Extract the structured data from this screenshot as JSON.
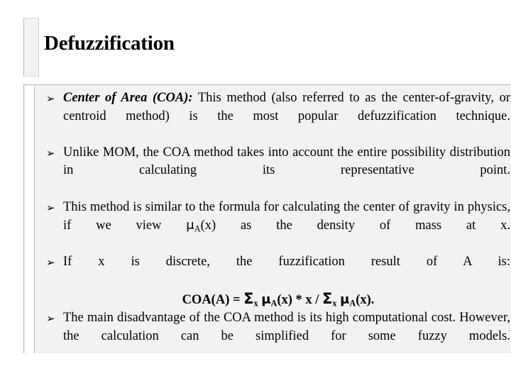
{
  "slide": {
    "title": "Defuzzification",
    "bullet_marker": "➢",
    "colors": {
      "page_background": "#ffffff",
      "content_background": "#f2f2f2",
      "text": "#000000",
      "border": "#b5b5b5",
      "deco_bar": "#f2f2f2"
    },
    "bullets": [
      {
        "id": "coa-definition",
        "lead_in": "Center of Area (COA):",
        "text": " This method (also referred to as the center-of-gravity, or centroid method) is the most popular defuzzification technique."
      },
      {
        "id": "unlike-mom",
        "lead_in": "",
        "text": "Unlike MOM, the COA method takes into account the entire possibility distribution in calculating its representative point."
      },
      {
        "id": "center-of-gravity-analogy",
        "lead_in": "",
        "text_part1": "This method is similar to the formula for calculating the center of gravity in physics, if we view ",
        "mu": "μ",
        "mu_subscript": "A",
        "text_part2": "(x) as the density of mass at x."
      },
      {
        "id": "discrete-case",
        "lead_in": "",
        "text": "If x is discrete, the fuzzification result of A is:",
        "formula": {
          "prefix": "COA(A) = ",
          "sigma1": "Σ",
          "sigma1_sub": "x",
          "mu1": "μ",
          "mu1_sub": "A",
          "mid": "(x) * x / ",
          "sigma2": "Σ",
          "sigma2_sub": "x",
          "mu2": "μ",
          "mu2_sub": "A",
          "suffix": "(x).",
          "plain": "COA(A) = Σx μA(x) * x / Σx μA(x)."
        }
      },
      {
        "id": "disadvantage",
        "lead_in": "",
        "text": "The main disadvantage of the COA method is its high computational cost. However, the calculation can be simplified for some fuzzy models."
      }
    ]
  }
}
